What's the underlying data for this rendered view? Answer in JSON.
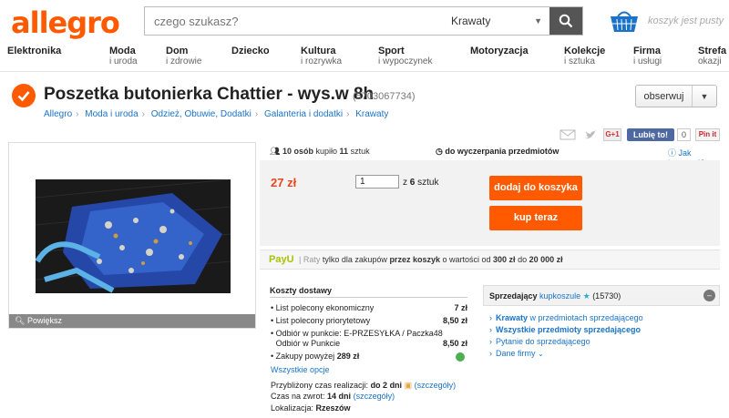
{
  "header": {
    "logo": "allegro",
    "search_placeholder": "czego szukasz?",
    "search_category": "Krawaty",
    "cart_text": "koszyk jest pusty"
  },
  "nav": [
    {
      "title": "Elektronika",
      "sub": ""
    },
    {
      "title": "Moda",
      "sub": "i uroda"
    },
    {
      "title": "Dom",
      "sub": "i zdrowie"
    },
    {
      "title": "Dziecko",
      "sub": ""
    },
    {
      "title": "Kultura",
      "sub": "i rozrywka"
    },
    {
      "title": "Sport",
      "sub": "i wypoczynek"
    },
    {
      "title": "Motoryzacja",
      "sub": ""
    },
    {
      "title": "Kolekcje",
      "sub": "i sztuka"
    },
    {
      "title": "Firma",
      "sub": "i usługi"
    },
    {
      "title": "Strefa",
      "sub": "okazji"
    }
  ],
  "offer": {
    "title": "Poszetka butonierka Chattier - wys.w 8h",
    "id": "(5703067734)",
    "observe_label": "obserwuj"
  },
  "breadcrumbs": [
    "Allegro",
    "Moda i uroda",
    "Odzież, Obuwie, Dodatki",
    "Galanteria i dodatki",
    "Krawaty"
  ],
  "social": {
    "gplus": "G+1",
    "fb_like": "Lubię to!",
    "fb_count": "0",
    "pinit": "Pin it"
  },
  "gallery": {
    "zoom_label": "Powiększ"
  },
  "purchase": {
    "buyers_count": "10",
    "buyers_text": "osób",
    "bought_text": "kupiło",
    "items_count": "11",
    "items_text": "sztuk",
    "ends_text": "do wyczerpania przedmiotów",
    "help_text": "Jak kupować?",
    "price": "27 zł",
    "quantity": "1",
    "of_text": "z",
    "available": "6",
    "unit": "sztuk",
    "add_to_cart": "dodaj do koszyka",
    "buy_now": "kup teraz"
  },
  "payu": {
    "logo": "PayU",
    "raty": "Raty",
    "t1": "tylko dla zakupów",
    "t2": "przez koszyk",
    "t3": "o wartości od",
    "min": "300 zł",
    "t4": "do",
    "max": "20 000 zł"
  },
  "shipping": {
    "title": "Koszty dostawy",
    "rows": [
      {
        "label": "List polecony ekonomiczny",
        "price": "7 zł"
      },
      {
        "label": "List polecony priorytetowy",
        "price": "8,50 zł"
      },
      {
        "label": "Odbiór w punkcie: E-PRZESYŁKA / Paczka48",
        "price": ""
      },
      {
        "label": "Odbiór w Punkcie",
        "price": "8,50 zł"
      }
    ],
    "free_label": "Zakupy powyżej",
    "free_value": "289 zł",
    "more_options": "Wszystkie opcje",
    "realization_label": "Przybliżony czas realizacji:",
    "realization_value": "do 2 dni",
    "details": "(szczegóły)",
    "return_label": "Czas na zwrot:",
    "return_value": "14 dni",
    "location_label": "Lokalizacja:",
    "location_value": "Rzeszów"
  },
  "seller": {
    "label": "Sprzedający",
    "name": "kupkoszule",
    "rating": "(15730)",
    "links": [
      {
        "bold": "Krawaty",
        "rest": " w przedmiotach sprzedającego"
      },
      {
        "bold": "Wszystkie przedmioty sprzedającego",
        "rest": ""
      },
      {
        "bold": "",
        "rest": "Pytanie do sprzedającego"
      },
      {
        "bold": "",
        "rest": "Dane firmy"
      }
    ]
  },
  "colors": {
    "brand": "#ff5a00",
    "link": "#1a73c8",
    "price": "#e8461e"
  }
}
